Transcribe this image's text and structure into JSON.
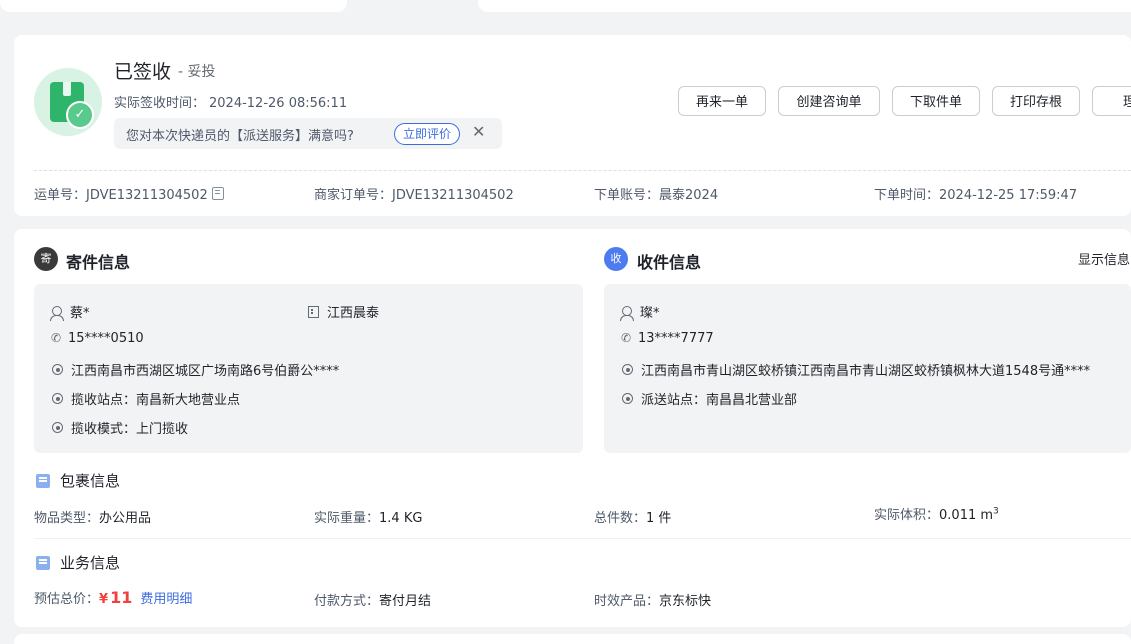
{
  "status": {
    "title": "已签收",
    "subtitle": "- 妥投",
    "sign_time_label": "实际签收时间：",
    "sign_time": "2024-12-26 08:56:11",
    "survey_question": "您对本次快递员的【派送服务】满意吗?",
    "survey_button": "立即评价",
    "close_glyph": "✕"
  },
  "actions": [
    "再来一单",
    "创建咨询单",
    "下取件单",
    "打印存根",
    "理赔"
  ],
  "order_meta": {
    "waybill_label": "运单号：",
    "waybill": "JDVE13211304502",
    "merchant_label": "商家订单号：",
    "merchant": "JDVE13211304502",
    "account_label": "下单账号：",
    "account": "晨泰2024",
    "time_label": "下单时间：",
    "time": "2024-12-25 17:59:47"
  },
  "sender": {
    "badge": "寄",
    "title": "寄件信息",
    "name": "蔡*",
    "company": "江西晨泰",
    "phone": "15****0510",
    "address": "江西南昌市西湖区城区广场南路6号伯爵公****",
    "station": "揽收站点：南昌新大地营业点",
    "mode": "揽收模式：上门揽收"
  },
  "receiver": {
    "badge": "收",
    "title": "收件信息",
    "show_info": "显示信息",
    "name": "璨*",
    "phone": "13****7777",
    "address": "江西南昌市青山湖区蛟桥镇江西南昌市青山湖区蛟桥镇枫林大道1548号通****",
    "station": "派送站点：南昌昌北营业部"
  },
  "package": {
    "title": "包裹信息",
    "type_label": "物品类型：",
    "type": "办公用品",
    "weight_label": "实际重量：",
    "weight": "1.4 KG",
    "count_label": "总件数：",
    "count": "1 件",
    "volume_label": "实际体积：",
    "volume": "0.011 m",
    "volume_sup": "3"
  },
  "business": {
    "title": "业务信息",
    "price_label": "预估总价：",
    "currency": "¥",
    "price": "11",
    "fee_link": "费用明细",
    "payment_label": "付款方式：",
    "payment": "寄付月结",
    "product_label": "时效产品：",
    "product": "京东标快"
  },
  "colors": {
    "accent": "#3c6ddc",
    "success": "#2fb56b",
    "price": "#f53f3f",
    "sender_badge": "#3a3a3a",
    "receiver_badge": "#4c7cf0"
  }
}
